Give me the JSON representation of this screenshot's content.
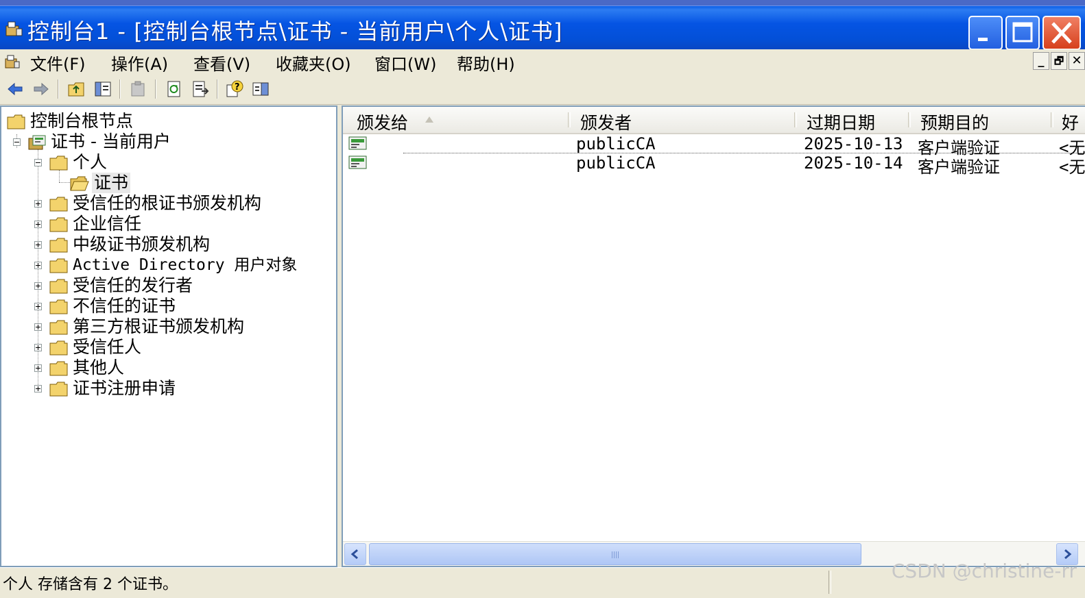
{
  "window": {
    "title": "控制台1 - [控制台根节点\\证书 - 当前用户\\个人\\证书]"
  },
  "menu": {
    "items": [
      {
        "label": "文件(F)"
      },
      {
        "label": "操作(A)"
      },
      {
        "label": "查看(V)"
      },
      {
        "label": "收藏夹(O)"
      },
      {
        "label": "窗口(W)"
      },
      {
        "label": "帮助(H)"
      }
    ],
    "mdi_buttons": [
      "_",
      "🗗",
      "✕"
    ]
  },
  "toolbar": {
    "buttons": [
      "back-icon",
      "forward-icon",
      "up-folder-icon",
      "show-hide-tree-icon",
      "paste-icon",
      "refresh-icon",
      "export-list-icon",
      "help-icon",
      "console-tree-icon"
    ]
  },
  "tree": {
    "root": "控制台根节点",
    "store": "证书 - 当前用户",
    "personal": "个人",
    "selected": "证书",
    "items": [
      {
        "label": "受信任的根证书颁发机构"
      },
      {
        "label": "企业信任"
      },
      {
        "label": "中级证书颁发机构"
      },
      {
        "label": "Active Directory 用户对象"
      },
      {
        "label": "受信任的发行者"
      },
      {
        "label": "不信任的证书"
      },
      {
        "label": "第三方根证书颁发机构"
      },
      {
        "label": "受信任人"
      },
      {
        "label": "其他人"
      },
      {
        "label": "证书注册申请"
      }
    ]
  },
  "list": {
    "columns": [
      {
        "label": "颁发给"
      },
      {
        "label": "颁发者"
      },
      {
        "label": "过期日期"
      },
      {
        "label": "预期目的"
      },
      {
        "label": "好"
      }
    ],
    "rows": [
      {
        "issued_to": "",
        "issuer": "publicCA",
        "expires": "2025-10-13",
        "purpose": "客户端验证",
        "friendly": "<无"
      },
      {
        "issued_to": "",
        "issuer": "publicCA",
        "expires": "2025-10-14",
        "purpose": "客户端验证",
        "friendly": "<无"
      }
    ]
  },
  "status": {
    "text": "个人 存储含有 2 个证书。",
    "watermark": "CSDN @christine-rr"
  },
  "colors": {
    "title_bar": "#0554e3",
    "selection": "#e8e8e8",
    "pane_border": "#7f9db9"
  }
}
